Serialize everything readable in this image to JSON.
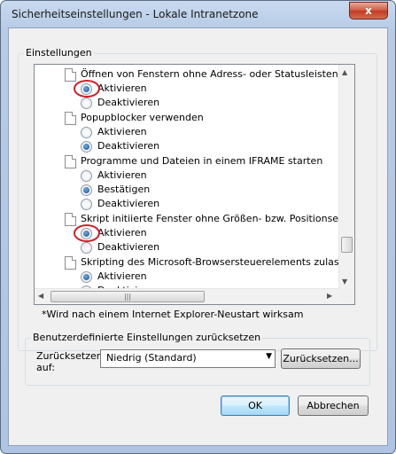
{
  "window": {
    "title": "Sicherheitseinstellungen - Lokale Intranetzone",
    "close_label": "x"
  },
  "settings_group": {
    "label": "Einstellungen"
  },
  "items": [
    {
      "type": "header",
      "label": "Öffnen von Fenstern ohne Adress- oder Statusleisten für We"
    },
    {
      "type": "option",
      "label": "Aktivieren",
      "selected": true,
      "highlighted": true
    },
    {
      "type": "option",
      "label": "Deaktivieren",
      "selected": false
    },
    {
      "type": "header",
      "label": "Popupblocker verwenden"
    },
    {
      "type": "option",
      "label": "Aktivieren",
      "selected": false
    },
    {
      "type": "option",
      "label": "Deaktivieren",
      "selected": true
    },
    {
      "type": "header",
      "label": "Programme und Dateien in einem IFRAME starten"
    },
    {
      "type": "option",
      "label": "Aktivieren",
      "selected": false
    },
    {
      "type": "option",
      "label": "Bestätigen",
      "selected": true
    },
    {
      "type": "option",
      "label": "Deaktivieren",
      "selected": false
    },
    {
      "type": "header",
      "label": "Skript initiierte Fenster ohne Größen- bzw. Positionseinschrän"
    },
    {
      "type": "option",
      "label": "Aktivieren",
      "selected": true,
      "highlighted": true
    },
    {
      "type": "option",
      "label": "Deaktivieren",
      "selected": false
    },
    {
      "type": "header",
      "label": "Skripting des Microsoft-Browsersteuerelements zulassen"
    },
    {
      "type": "option",
      "label": "Aktivieren",
      "selected": true
    },
    {
      "type": "option",
      "label": "Deaktivieren",
      "selected": false
    }
  ],
  "scroll": {
    "vertical_position": 0.85,
    "horizontal_position": 0.0
  },
  "restart_note": "*Wird nach einem Internet Explorer-Neustart wirksam",
  "reset_group": {
    "label": "Benutzerdefinierte Einstellungen zurücksetzen",
    "reset_to_label_line1": "Zurücksetzen",
    "reset_to_label_line2": "auf:",
    "combo_value": "Niedrig (Standard)",
    "reset_button": "Zurücksetzen..."
  },
  "buttons": {
    "ok": "OK",
    "cancel": "Abbrechen"
  }
}
